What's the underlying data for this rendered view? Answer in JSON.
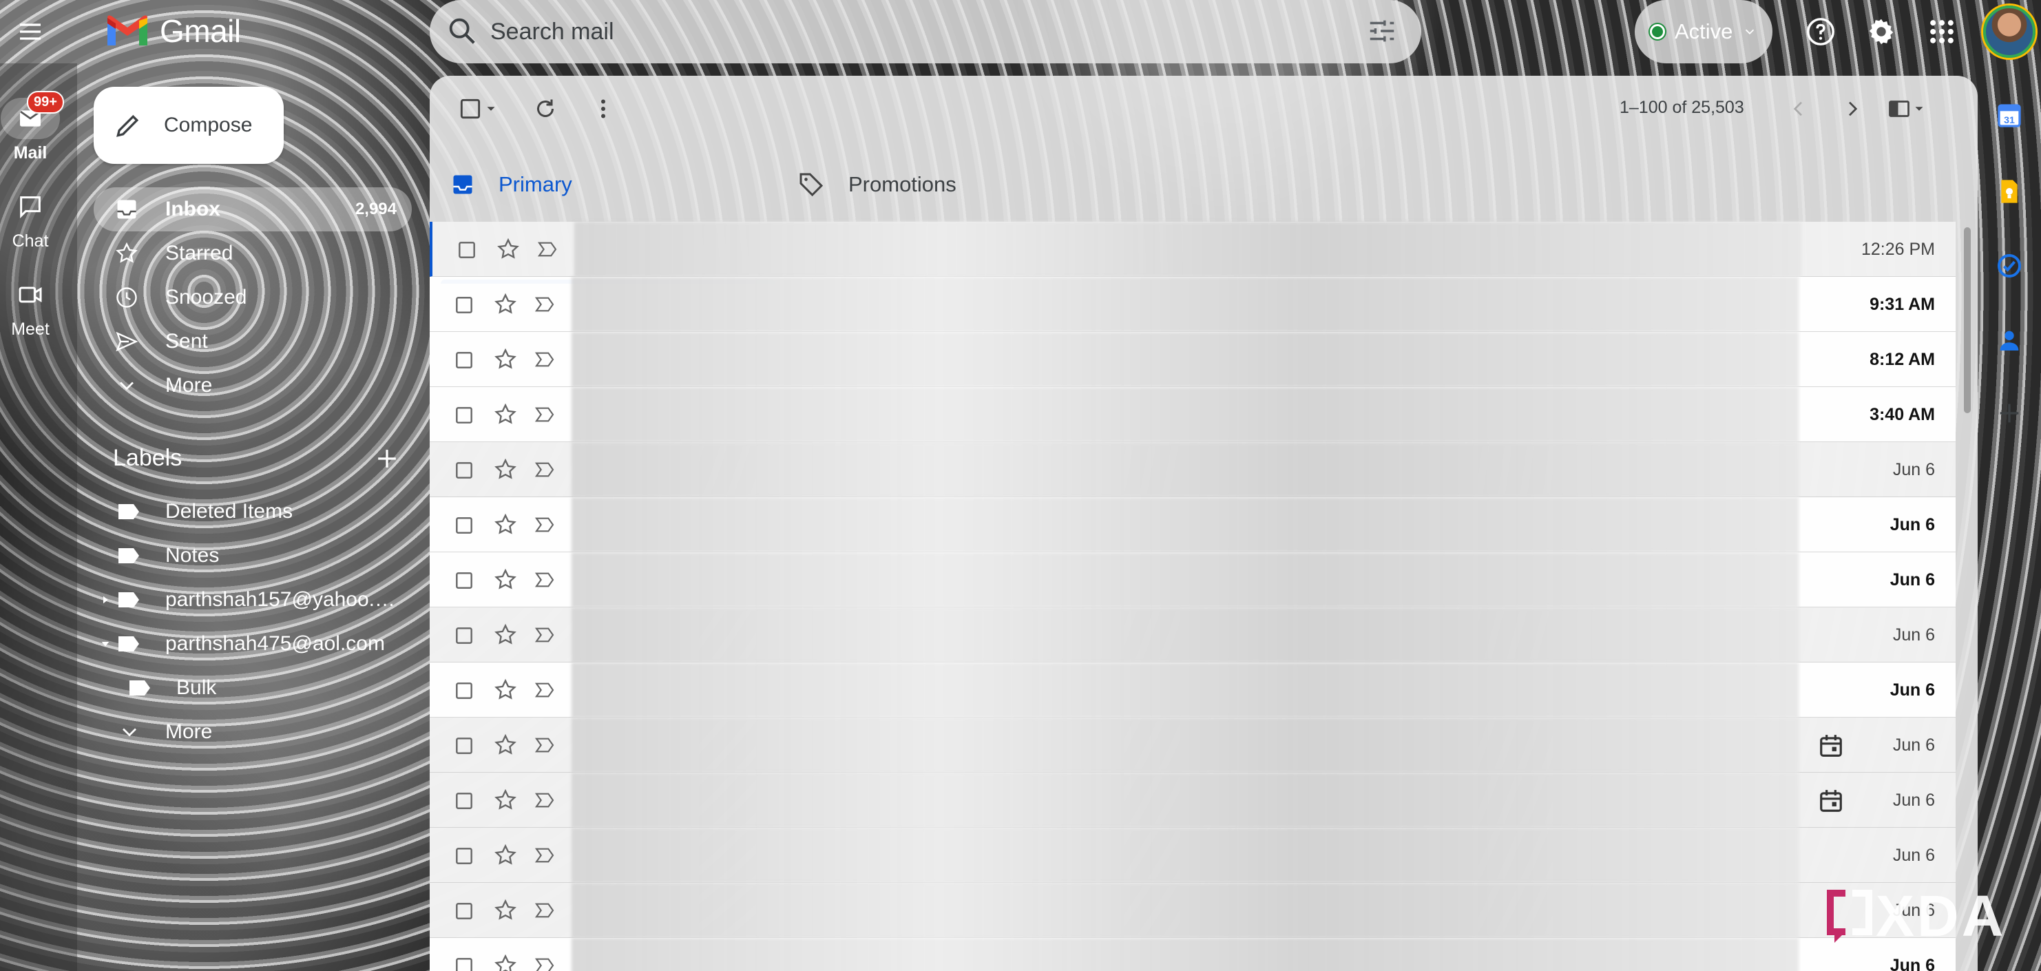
{
  "app": {
    "name": "Gmail"
  },
  "search": {
    "placeholder": "Search mail"
  },
  "status": {
    "label": "Active",
    "color": "#1e8e3e"
  },
  "rail": {
    "items": [
      {
        "label": "Mail",
        "badge": "99+"
      },
      {
        "label": "Chat"
      },
      {
        "label": "Meet"
      }
    ]
  },
  "compose": {
    "label": "Compose"
  },
  "nav": {
    "items": [
      {
        "label": "Inbox",
        "count": "2,994"
      },
      {
        "label": "Starred"
      },
      {
        "label": "Snoozed"
      },
      {
        "label": "Sent"
      },
      {
        "label": "More"
      }
    ]
  },
  "labels": {
    "heading": "Labels",
    "items": [
      {
        "label": "Deleted Items"
      },
      {
        "label": "Notes"
      },
      {
        "label": "parthshah157@yahoo.co..."
      },
      {
        "label": "parthshah475@aol.com"
      },
      {
        "label": "Bulk"
      },
      {
        "label": "More"
      }
    ]
  },
  "toolbar": {
    "pager": "1–100 of 25,503"
  },
  "tabs": [
    {
      "label": "Primary"
    },
    {
      "label": "Promotions"
    }
  ],
  "emails": [
    {
      "time": "12:26 PM",
      "unread": false,
      "calendar": false
    },
    {
      "time": "9:31 AM",
      "unread": true,
      "calendar": false
    },
    {
      "time": "8:12 AM",
      "unread": true,
      "calendar": false
    },
    {
      "time": "3:40 AM",
      "unread": true,
      "calendar": false
    },
    {
      "time": "Jun 6",
      "unread": false,
      "calendar": false
    },
    {
      "time": "Jun 6",
      "unread": true,
      "calendar": false
    },
    {
      "time": "Jun 6",
      "unread": true,
      "calendar": false
    },
    {
      "time": "Jun 6",
      "unread": false,
      "calendar": false
    },
    {
      "time": "Jun 6",
      "unread": true,
      "calendar": false
    },
    {
      "time": "Jun 6",
      "unread": false,
      "calendar": true
    },
    {
      "time": "Jun 6",
      "unread": false,
      "calendar": true
    },
    {
      "time": "Jun 6",
      "unread": false,
      "calendar": false
    },
    {
      "time": "Jun 6",
      "unread": false,
      "calendar": false
    },
    {
      "time": "Jun 6",
      "unread": true,
      "calendar": false
    }
  ],
  "watermark": {
    "text": "XDA"
  },
  "colors": {
    "accent": "#0b57d0",
    "badge": "#d93025"
  }
}
